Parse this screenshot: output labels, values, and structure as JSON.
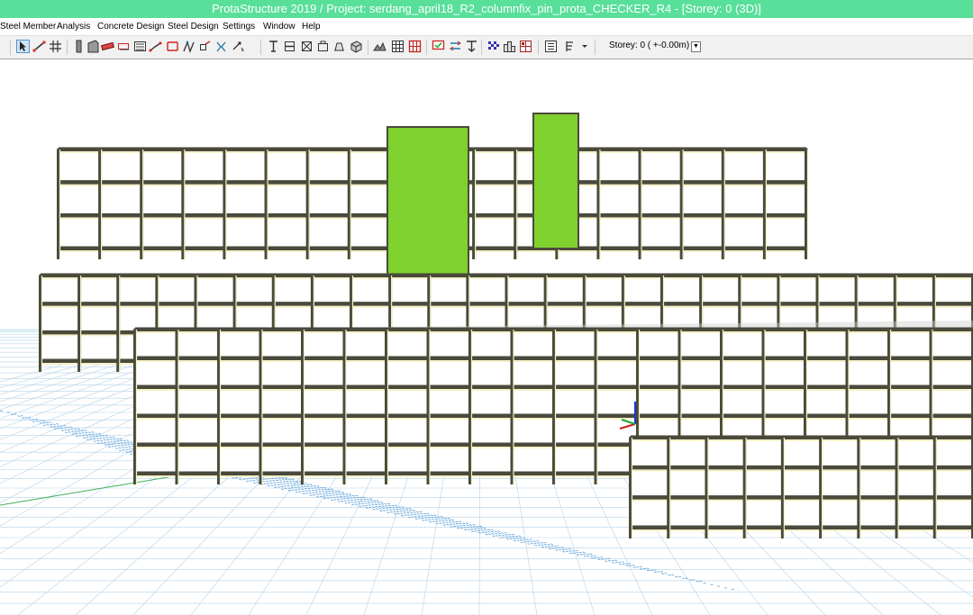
{
  "window": {
    "title": "ProtaStructure 2019 / Project: serdang_april18_R2_columnfix_pin_prota_CHECKER_R4 - [Storey: 0 (3D)]"
  },
  "menu": {
    "items": [
      {
        "label": "Steel Member"
      },
      {
        "label": "Analysis"
      },
      {
        "label": "Concrete Design"
      },
      {
        "label": "Steel Design"
      },
      {
        "label": "Settings"
      },
      {
        "label": "Window"
      },
      {
        "label": "Help"
      }
    ]
  },
  "toolbar": {
    "icons": [
      "select-arrow-icon",
      "node-link-icon",
      "grid-icon",
      "column-icon",
      "wall-icon",
      "beam-icon",
      "slab-icon",
      "stair-icon",
      "frame-icon",
      "brace-icon",
      "truss-icon",
      "hinge-icon",
      "support-icon",
      "dimension-icon",
      "text-icon",
      "section-icon",
      "axis-icon",
      "view-icon",
      "elevation-icon",
      "3d-view-icon",
      "table-icon",
      "check-icon",
      "load-icon",
      "result-icon",
      "pattern-icon",
      "report-icon",
      "graph-icon",
      "list-icon",
      "window-icon"
    ],
    "storey_label": "Storey: 0 ( +-0.00m)",
    "storey_dropdown_icon": "chevron-down-icon"
  },
  "viewport": {
    "name": "3d-model-view",
    "colors": {
      "frame_dark": "#4a4a3c",
      "beam_cream": "#f5f2c8",
      "slab_grey": "#cfcfcf",
      "core_green": "#7fd12e",
      "grid_blue": "#b3d3ea",
      "axis_dot_blue": "#5a9ed6",
      "axis_line_green": "#3fae59"
    }
  }
}
